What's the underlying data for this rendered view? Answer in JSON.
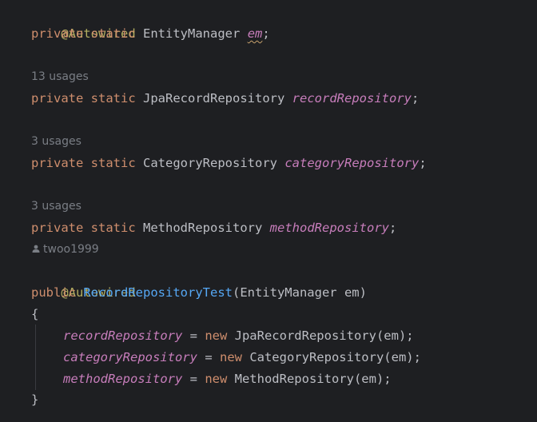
{
  "editor": {
    "line1": {
      "annotation": "@Autowired"
    },
    "line2": {
      "kw1": "private",
      "kw2": "static",
      "type": "EntityManager",
      "field": "em",
      "end": ";"
    },
    "hint1": "13 usages",
    "line3": {
      "kw1": "private",
      "kw2": "static",
      "type": "JpaRecordRepository",
      "field": "recordRepository",
      "end": ";"
    },
    "hint2": "3 usages",
    "line4": {
      "kw1": "private",
      "kw2": "static",
      "type": "CategoryRepository",
      "field": "categoryRepository",
      "end": ";"
    },
    "hint3": "3 usages",
    "line5": {
      "kw1": "private",
      "kw2": "static",
      "type": "MethodRepository",
      "field": "methodRepository",
      "end": ";"
    },
    "author_hint": {
      "icon": "user-icon",
      "name": "twoo1999"
    },
    "line6": {
      "annotation": "@Autowired"
    },
    "line7": {
      "kw": "public",
      "ctor": "RecordRepositoryTest",
      "params": "(EntityManager em)"
    },
    "line8": {
      "text": "{"
    },
    "line9": {
      "field": "recordRepository",
      "op": " = ",
      "kw": "new",
      "rest": " JpaRecordRepository(em);"
    },
    "line10": {
      "field": "categoryRepository",
      "op": " = ",
      "kw": "new",
      "rest": " CategoryRepository(em);"
    },
    "line11": {
      "field": "methodRepository",
      "op": " = ",
      "kw": "new",
      "rest": " MethodRepository(em);"
    },
    "line12": {
      "text": "}"
    }
  },
  "colors": {
    "background": "#1e1f22",
    "keyword": "#cf8e6d",
    "annotation": "#b3ae60",
    "field": "#c77dbb",
    "method": "#56a8f5",
    "text": "#bcbec4",
    "hint": "#7a7e85"
  }
}
